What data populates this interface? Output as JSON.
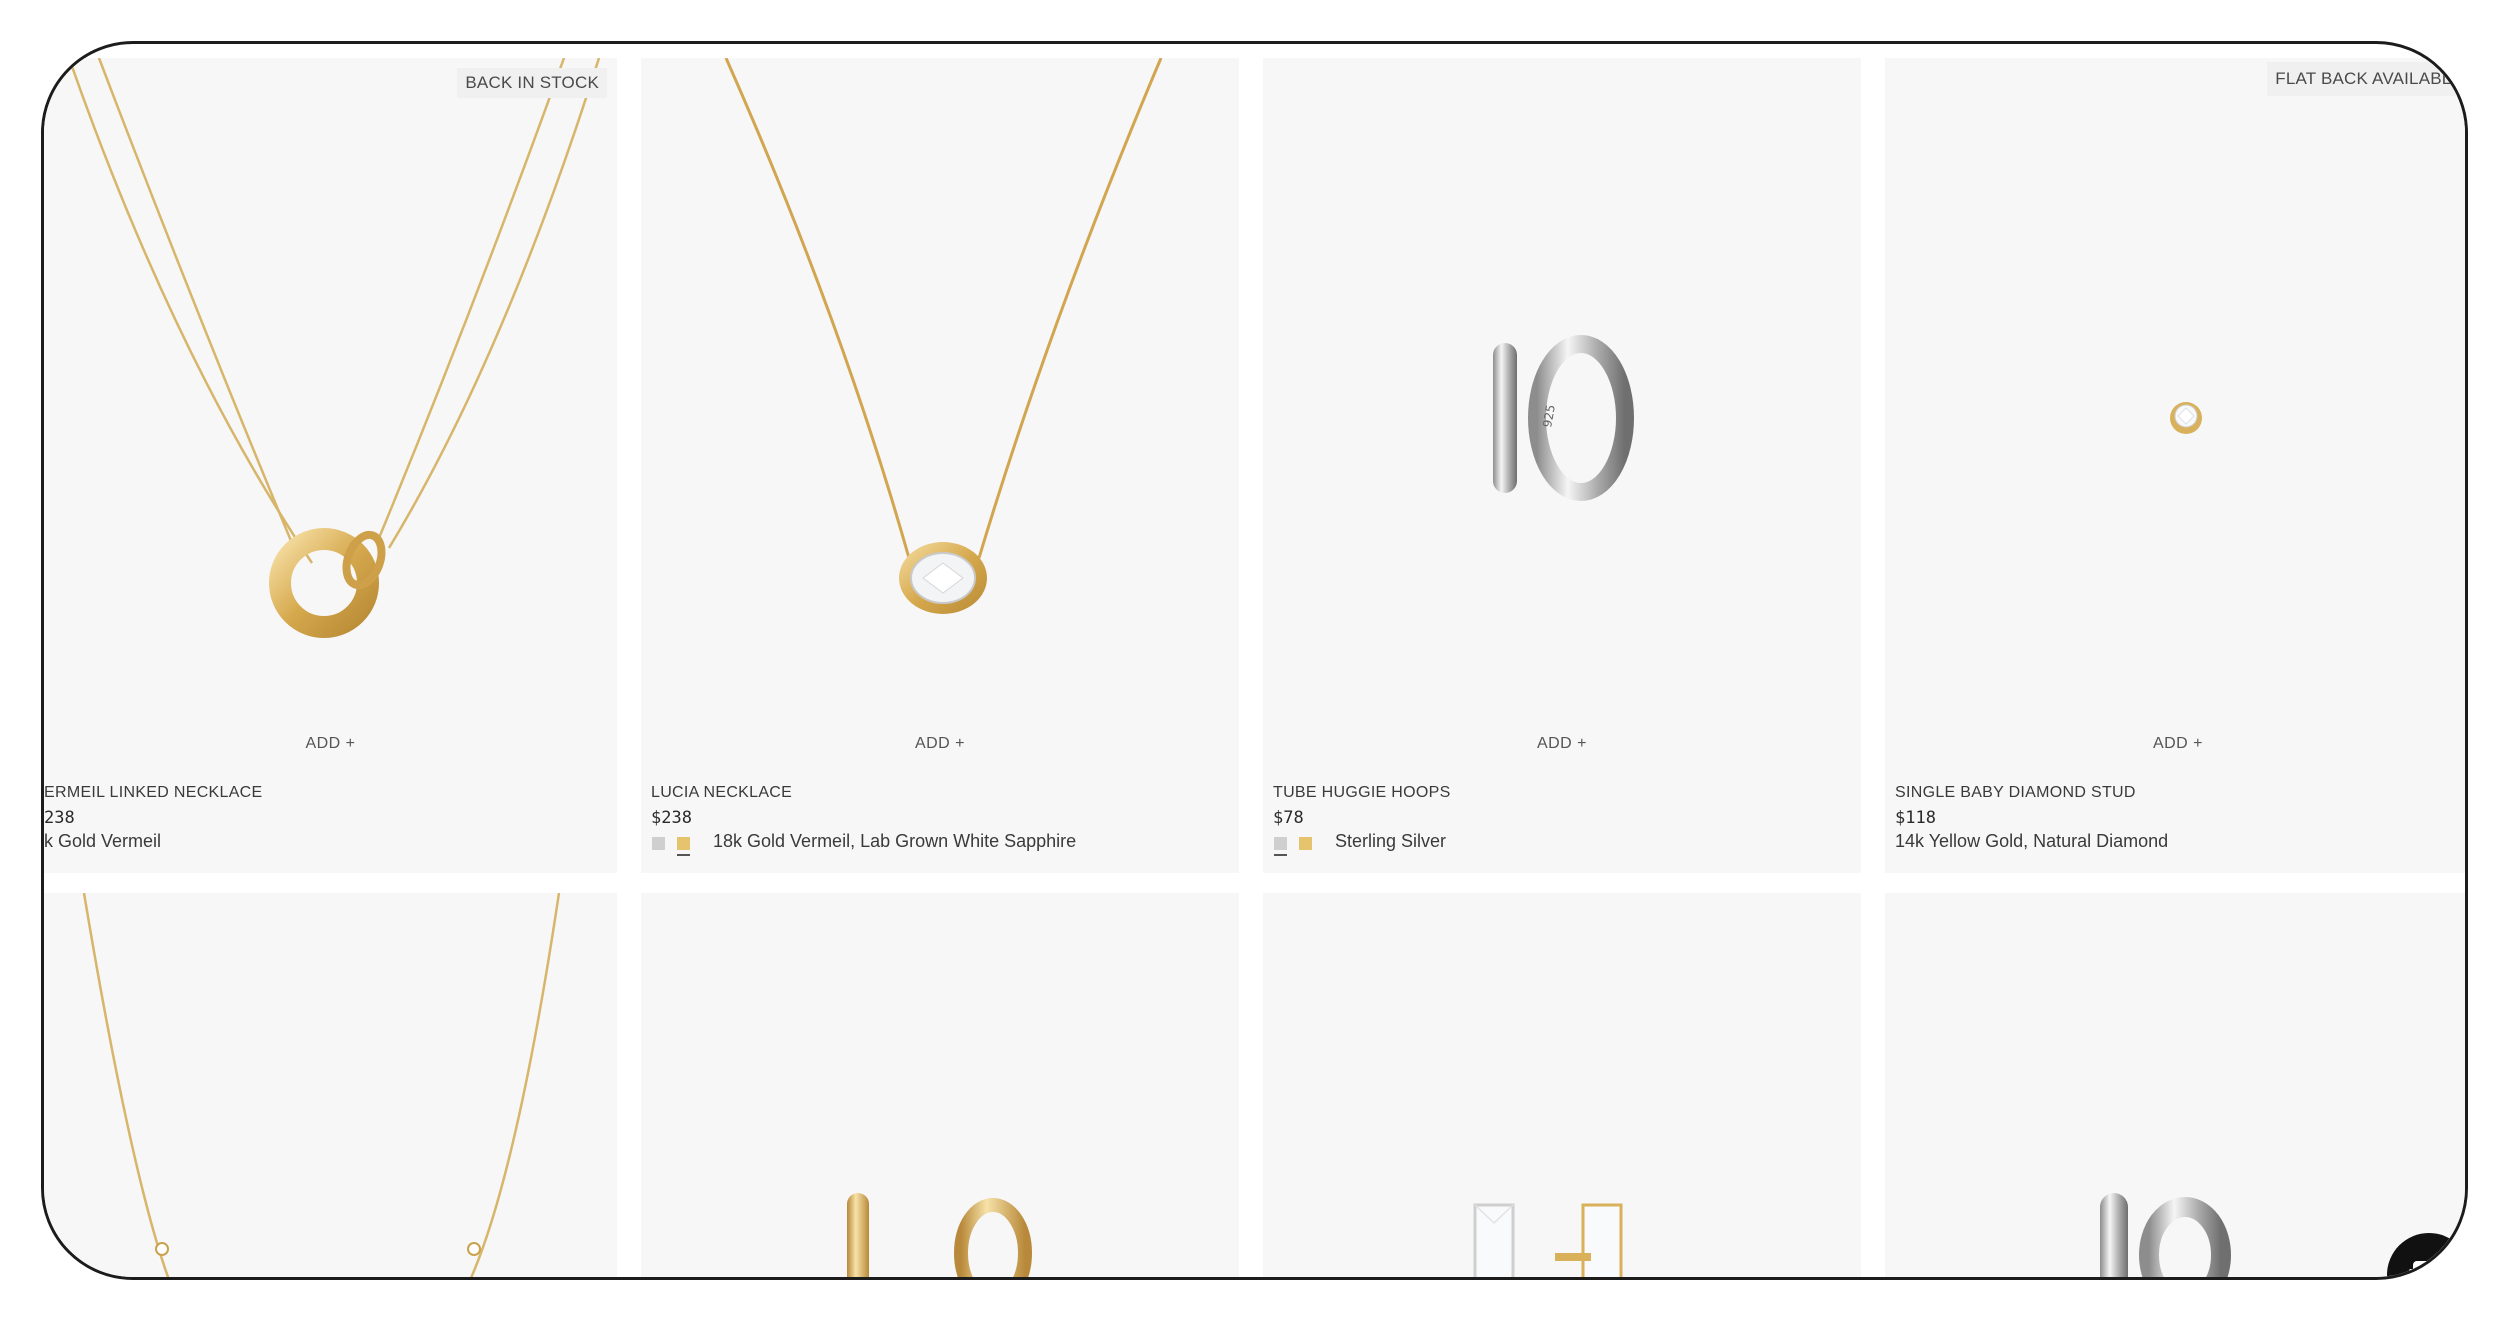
{
  "products": [
    {
      "badge": "BACK IN STOCK",
      "add_label": "ADD +",
      "name": "ERMEIL LINKED NECKLACE",
      "price": "238",
      "material": "k Gold Vermeil",
      "swatches": []
    },
    {
      "badge": "",
      "add_label": "ADD +",
      "name": "LUCIA NECKLACE",
      "price": "$238",
      "material": "18k Gold Vermeil, Lab Grown White Sapphire",
      "swatches": [
        "silver",
        "gold"
      ]
    },
    {
      "badge": "",
      "add_label": "ADD +",
      "name": "TUBE HUGGIE HOOPS",
      "price": "$78",
      "material": "Sterling Silver",
      "swatches": [
        "silver",
        "gold"
      ]
    },
    {
      "badge": "FLAT BACK AVAILABLE",
      "add_label": "ADD +",
      "name": "SINGLE BABY DIAMOND STUD",
      "price": "$118",
      "material": "14k Yellow Gold, Natural Diamond",
      "swatches": []
    }
  ],
  "second_row": [
    {
      "image": "necklace-with-diamond-stations"
    },
    {
      "image": "gold-huggie-hoops"
    },
    {
      "image": "baguette-stud-earrings"
    },
    {
      "image": "silver-wide-huggie-hoops"
    }
  ],
  "chat": {
    "icon": "chat-bubble-icon"
  },
  "colors": {
    "card_bg": "#f7f7f7",
    "gold": "#d9b15a",
    "silver": "#c8c8c8",
    "frame": "#1c1c1c"
  }
}
